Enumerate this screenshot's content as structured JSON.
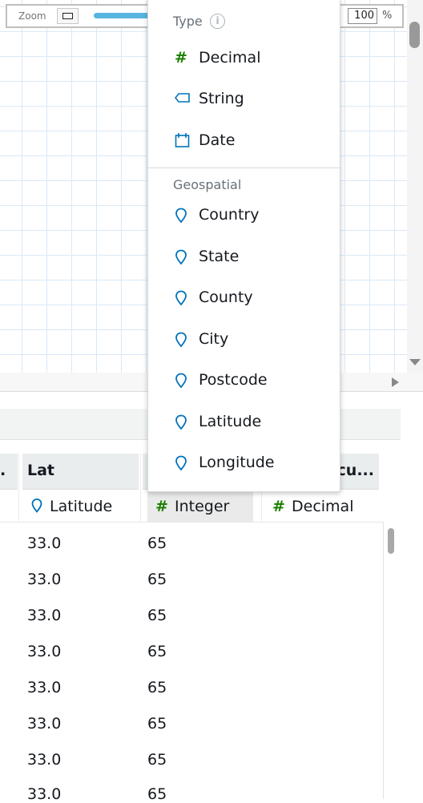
{
  "zoom": {
    "label": "Zoom",
    "value": "100",
    "unit": "%"
  },
  "grid": {
    "columns": [
      {
        "header": ".",
        "type_label": "",
        "type_icon": ""
      },
      {
        "header": "Lat",
        "type_label": "Latitude",
        "type_icon": "map-pin-icon"
      },
      {
        "header": "",
        "type_label": "Integer",
        "type_icon": "hash-icon"
      },
      {
        "header": "cu...",
        "type_label": "Decimal",
        "type_icon": "hash-icon"
      }
    ],
    "rows": [
      {
        "lat": "33.0",
        "integer": "65"
      },
      {
        "lat": "33.0",
        "integer": "65"
      },
      {
        "lat": "33.0",
        "integer": "65"
      },
      {
        "lat": "33.0",
        "integer": "65"
      },
      {
        "lat": "33.0",
        "integer": "65"
      },
      {
        "lat": "33.0",
        "integer": "65"
      },
      {
        "lat": "33.0",
        "integer": "65"
      },
      {
        "lat": "33.0",
        "integer": "65"
      }
    ]
  },
  "menu": {
    "type_title": "Type",
    "type_items": [
      {
        "label": "Decimal",
        "icon": "hash-icon"
      },
      {
        "label": "String",
        "icon": "tag-icon"
      },
      {
        "label": "Date",
        "icon": "calendar-icon"
      }
    ],
    "geo_title": "Geospatial",
    "geo_items": [
      {
        "label": "Country",
        "icon": "map-pin-icon"
      },
      {
        "label": "State",
        "icon": "map-pin-icon"
      },
      {
        "label": "County",
        "icon": "map-pin-icon"
      },
      {
        "label": "City",
        "icon": "map-pin-icon"
      },
      {
        "label": "Postcode",
        "icon": "map-pin-icon"
      },
      {
        "label": "Latitude",
        "icon": "map-pin-icon"
      },
      {
        "label": "Longitude",
        "icon": "map-pin-icon"
      }
    ]
  },
  "colors": {
    "accent_blue": "#0073bb",
    "numeric_green": "#1d8102",
    "slider_blue": "#58b4e0"
  }
}
